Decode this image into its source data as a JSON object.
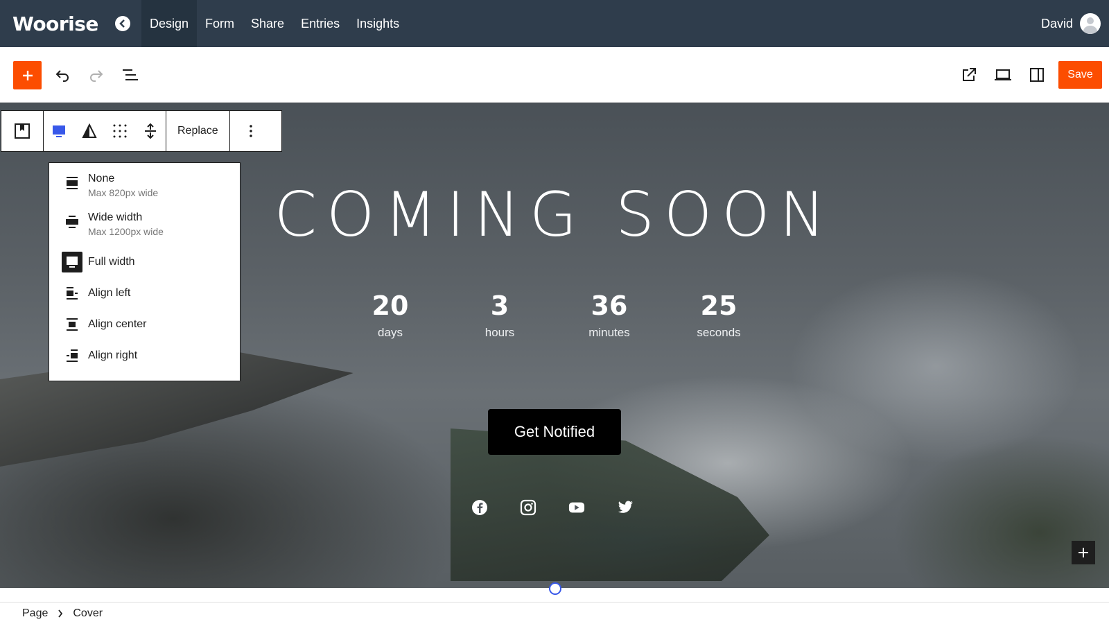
{
  "app": {
    "logo": "Woorise"
  },
  "nav": {
    "tabs": [
      {
        "label": "Design",
        "active": true
      },
      {
        "label": "Form"
      },
      {
        "label": "Share"
      },
      {
        "label": "Entries"
      },
      {
        "label": "Insights"
      }
    ],
    "user_name": "David"
  },
  "toolbar": {
    "save_label": "Save",
    "accent_color": "#fc4d01"
  },
  "block_toolbar": {
    "replace_label": "Replace"
  },
  "align_menu": {
    "items": [
      {
        "label": "None",
        "sub": "Max 820px wide",
        "icon": "align-none-icon"
      },
      {
        "label": "Wide width",
        "sub": "Max 1200px wide",
        "icon": "align-wide-icon"
      },
      {
        "label": "Full width",
        "sub": "",
        "icon": "align-full-icon",
        "selected": true
      },
      {
        "label": "Align left",
        "sub": "",
        "icon": "align-left-icon"
      },
      {
        "label": "Align center",
        "sub": "",
        "icon": "align-center-icon"
      },
      {
        "label": "Align right",
        "sub": "",
        "icon": "align-right-icon"
      }
    ]
  },
  "cover": {
    "title": "COMING SOON",
    "countdown": [
      {
        "value": "20",
        "label": "days"
      },
      {
        "value": "3",
        "label": "hours"
      },
      {
        "value": "36",
        "label": "minutes"
      },
      {
        "value": "25",
        "label": "seconds"
      }
    ],
    "button_label": "Get Notified",
    "social": [
      "facebook-icon",
      "instagram-icon",
      "youtube-icon",
      "twitter-icon"
    ]
  },
  "breadcrumb": {
    "items": [
      "Page",
      "Cover"
    ]
  }
}
